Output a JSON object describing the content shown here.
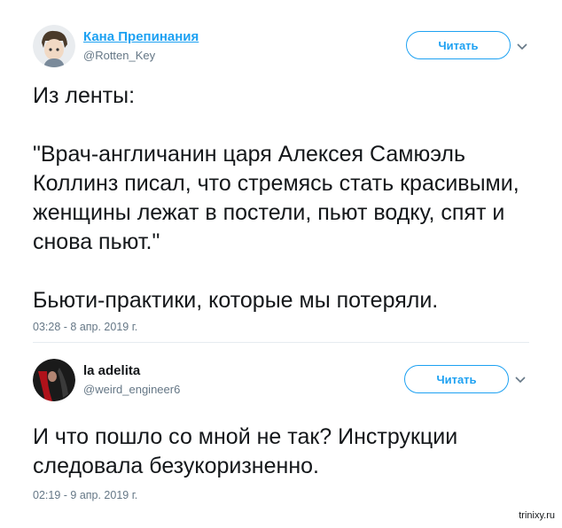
{
  "tweets": [
    {
      "display_name": "Кана Препинания",
      "handle": "@Rotten_Key",
      "follow_label": "Читать",
      "text": "Из ленты:\n\n\"Врач-англичанин царя Алексея Самюэль Коллинз писал, что стремясь стать красивыми, женщины лежат в постели, пьют водку, спят и снова пьют.\"\n\nБьюти-практики, которые мы потеряли.",
      "time": "03:28 - 8 апр. 2019 г."
    },
    {
      "display_name": "la adelita",
      "handle": "@weird_engineer6",
      "follow_label": "Читать",
      "text": "И что пошло со мной не так? Инструкции следовала безукоризненно.",
      "time": "02:19 - 9 апр. 2019 г."
    }
  ],
  "watermark": "trinixy.ru",
  "colors": {
    "accent": "#1da1f2",
    "muted": "#657786",
    "text": "#14171a"
  }
}
